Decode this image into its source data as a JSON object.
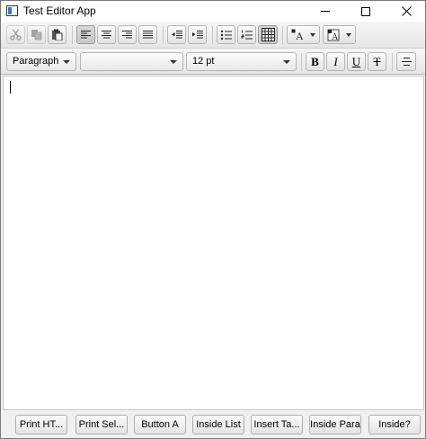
{
  "window": {
    "title": "Test Editor App"
  },
  "toolbar": {
    "icons": {
      "cut": "scissors-icon",
      "copy": "copy-icon",
      "paste": "paste-icon",
      "align_left": "align-left-icon",
      "align_center": "align-center-icon",
      "align_right": "align-right-icon",
      "justify": "align-justify-icon",
      "outdent": "outdent-icon",
      "indent": "indent-icon",
      "bullets": "bullet-list-icon",
      "numbers": "numbered-list-icon",
      "grid": "table-grid-icon",
      "text_color": "text-color-icon",
      "highlight": "background-color-icon"
    },
    "paragraph_style": "Paragraph",
    "font_family": "",
    "font_size": "12 pt",
    "bold_glyph": "B",
    "italic_glyph": "I",
    "underline_glyph": "U",
    "strike_glyph": "T",
    "text_color_glyph": "A"
  },
  "editor": {
    "content": ""
  },
  "buttons": [
    {
      "label": "Print HT..."
    },
    {
      "label": "Print Sel..."
    },
    {
      "label": "Button A"
    },
    {
      "label": "Inside List"
    },
    {
      "label": "Insert Ta..."
    },
    {
      "label": "Inside Para"
    },
    {
      "label": "Inside?"
    }
  ],
  "colors": {
    "selected_button": "#c8c8c8",
    "editor_bg": "#ffffff",
    "window_bg": "#f0f0f0"
  }
}
